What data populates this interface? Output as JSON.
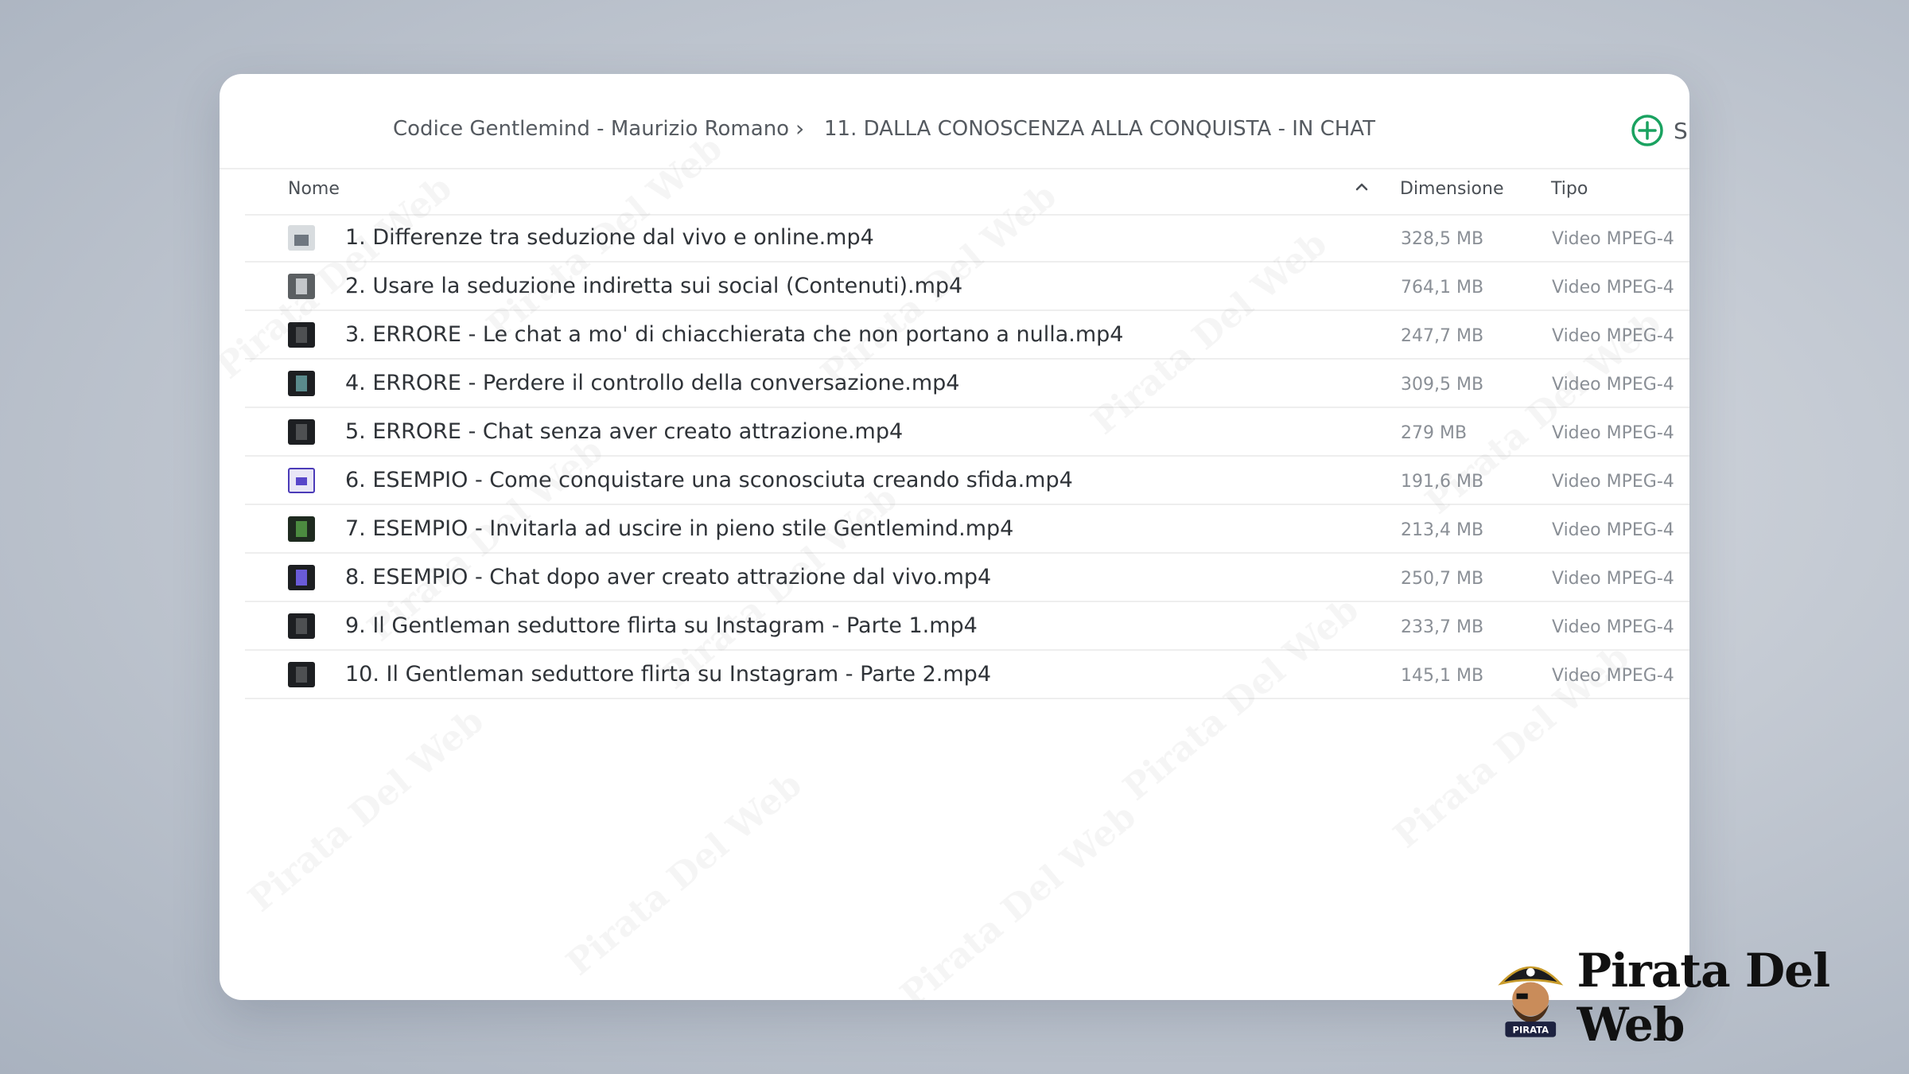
{
  "breadcrumb": {
    "items": [
      "Codice Gentlemind - Maurizio Romano",
      "11. DALLA CONOSCENZA ALLA CONQUISTA - IN CHAT"
    ],
    "separator": "›"
  },
  "toolbar": {
    "new_icon": "plus-circle-icon",
    "new_label": "S",
    "accent_color": "#1aa260"
  },
  "table": {
    "headers": {
      "name": "Nome",
      "size": "Dimensione",
      "type": "Tipo",
      "sort_icon": "chevron-up-icon"
    },
    "rows": [
      {
        "name": "1. Differenze tra seduzione dal vivo e online.mp4",
        "size": "328,5 MB",
        "type": "Video MPEG-4"
      },
      {
        "name": "2. Usare la seduzione indiretta sui social (Contenuti).mp4",
        "size": "764,1 MB",
        "type": "Video MPEG-4"
      },
      {
        "name": "3. ERRORE - Le chat a mo' di chiacchierata che non portano a nulla.mp4",
        "size": "247,7 MB",
        "type": "Video MPEG-4"
      },
      {
        "name": "4. ERRORE - Perdere il controllo della conversazione.mp4",
        "size": "309,5 MB",
        "type": "Video MPEG-4"
      },
      {
        "name": "5. ERRORE - Chat senza aver creato attrazione.mp4",
        "size": "279 MB",
        "type": "Video MPEG-4"
      },
      {
        "name": "6. ESEMPIO - Come conquistare una sconosciuta creando sfida.mp4",
        "size": "191,6 MB",
        "type": "Video MPEG-4"
      },
      {
        "name": "7. ESEMPIO - Invitarla ad uscire in pieno stile Gentlemind.mp4",
        "size": "213,4 MB",
        "type": "Video MPEG-4"
      },
      {
        "name": "8. ESEMPIO - Chat dopo aver creato attrazione dal vivo.mp4",
        "size": "250,7 MB",
        "type": "Video MPEG-4"
      },
      {
        "name": "9. Il Gentleman seduttore flirta su Instagram - Parte 1.mp4",
        "size": "233,7 MB",
        "type": "Video MPEG-4"
      },
      {
        "name": "10. Il Gentleman seduttore flirta su Instagram - Parte 2.mp4",
        "size": "145,1 MB",
        "type": "Video MPEG-4"
      }
    ]
  },
  "branding": {
    "logo_text": "Pirata Del Web",
    "badge_text": "PIRATA",
    "watermark_text": "Pirata Del Web"
  }
}
